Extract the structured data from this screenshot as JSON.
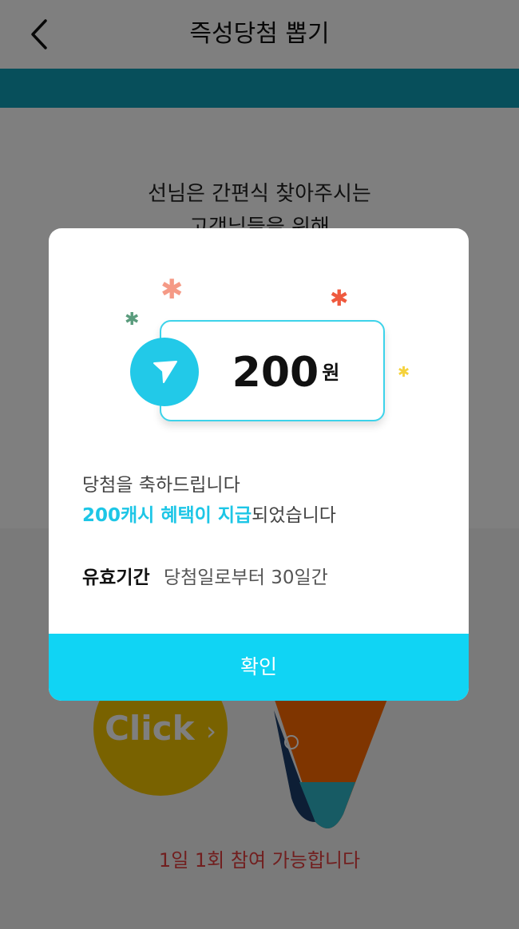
{
  "header": {
    "title": "즉성당첨 뽑기"
  },
  "intro": {
    "line1": "선님은 간편식 찾아주시는",
    "line2": "고객님들을 위해"
  },
  "game": {
    "click_label": "Click",
    "click_arrow": "›",
    "daily_note": "1일 1회 참여 가능합니다"
  },
  "modal": {
    "amount": "200",
    "unit": "원",
    "congrats": "당첨을 축하드립니다",
    "benefit_highlight": "200캐시 혜택이 지급",
    "benefit_rest": "되었습니다",
    "validity_label": "유효기간",
    "validity_value": "당첨일로부터 30일간",
    "confirm_label": "확인"
  },
  "colors": {
    "accent": "#10d4f4",
    "highlight_text": "#1dc6e6",
    "teal_band": "#0e9fb7",
    "click_button": "#f2c400",
    "notice_red": "#e33e3e"
  },
  "icons": {
    "back": "chevron-left-icon",
    "cash": "paper-plane-icon",
    "sparkle": "asterisk-sparkle-icon"
  }
}
